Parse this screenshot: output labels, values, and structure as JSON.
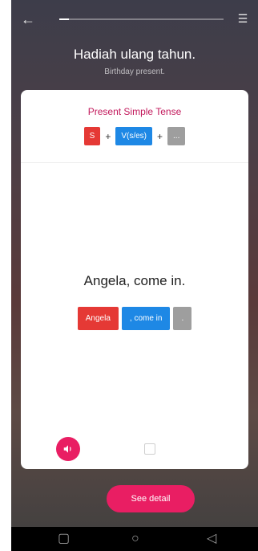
{
  "header": {
    "back_icon": "back-arrow-icon",
    "menu_icon": "list-menu-icon",
    "progress_fraction": 0.06
  },
  "lesson": {
    "title": "Hadiah ulang tahun.",
    "subtitle": "Birthday present."
  },
  "pattern": {
    "title": "Present Simple Tense",
    "chips": [
      "S",
      "+",
      "V(s/es)",
      "+",
      "..."
    ]
  },
  "sentence": {
    "text": "Angela, come in.",
    "blocks": [
      "Angela",
      ", come in",
      "."
    ]
  },
  "actions": {
    "audio_icon": "speaker-icon",
    "book_icon": "book-icon",
    "see_detail": "See detail"
  },
  "system_nav": {
    "recent_icon": "square-icon",
    "home_icon": "circle-icon",
    "back_icon": "triangle-back-icon"
  },
  "colors": {
    "accent_pink": "#e91e63",
    "title_magenta": "#c2185b",
    "chip_red": "#e53935",
    "chip_blue": "#1e88e5",
    "chip_gray": "#9e9e9e"
  }
}
